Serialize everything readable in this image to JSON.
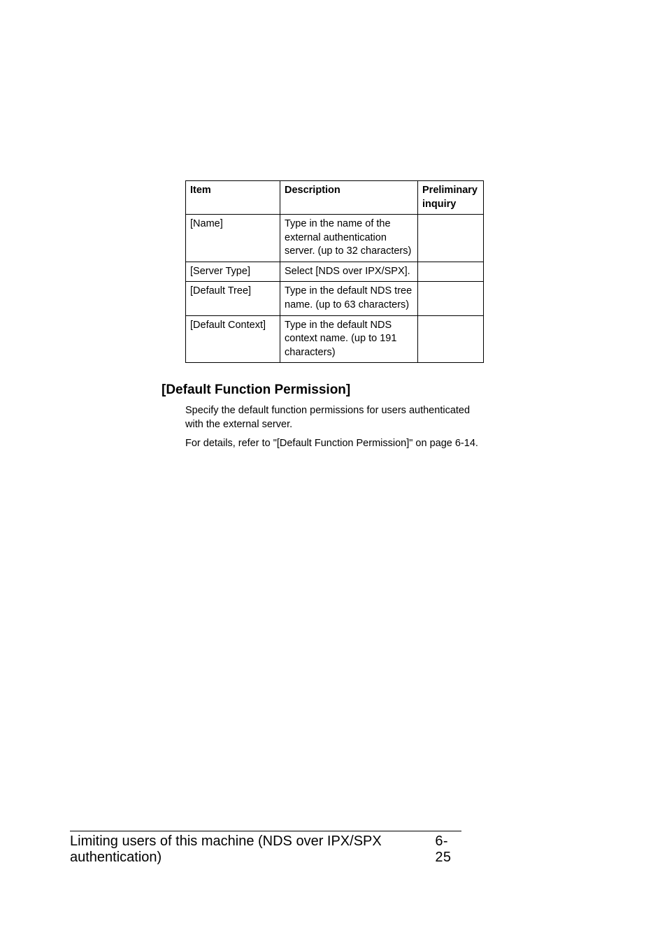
{
  "table": {
    "headers": [
      "Item",
      "Description",
      "Preliminary inquiry"
    ],
    "rows": [
      {
        "item": "[Name]",
        "desc": "Type in the name of the external authentication server. (up to 32 characters)",
        "inq": ""
      },
      {
        "item": "[Server Type]",
        "desc": "Select [NDS over IPX/SPX].",
        "inq": ""
      },
      {
        "item": "[Default Tree]",
        "desc": "Type in the default NDS tree name. (up to 63 characters)",
        "inq": ""
      },
      {
        "item": "[Default Context]",
        "desc": "Type in the default NDS context name. (up to 191 characters)",
        "inq": ""
      }
    ]
  },
  "heading": "[Default Function Permission]",
  "para1": "Specify the default function permissions for users authenticated with the external server.",
  "para2": "For details, refer to \"[Default Function Permission]\" on page 6-14.",
  "footer": {
    "title": "Limiting users of this machine (NDS over IPX/SPX authentication)",
    "page": "6-25"
  }
}
